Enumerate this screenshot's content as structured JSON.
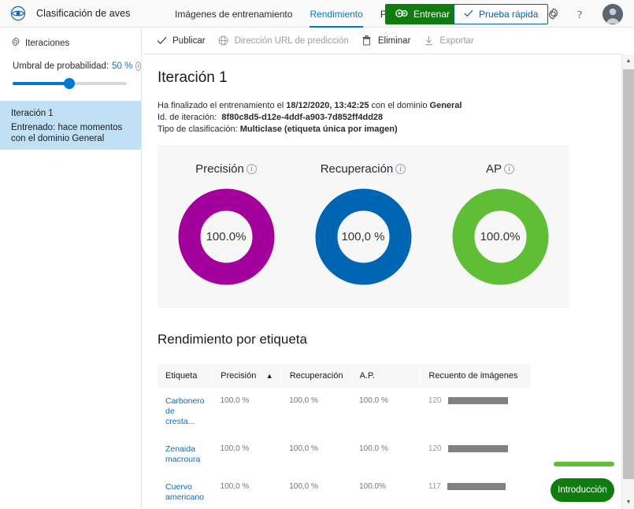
{
  "header": {
    "logo_icon": "eye-icon",
    "project_title": "Clasificación de aves",
    "tabs": [
      {
        "label": "Imágenes de entrenamiento",
        "active": false
      },
      {
        "label": "Rendimiento",
        "active": true
      },
      {
        "label": "Predicciones",
        "active": false
      }
    ],
    "train_button": "Entrenar",
    "quick_test_button": "Prueba rápida",
    "settings_icon": "gear-icon",
    "help_icon": "help-question-icon",
    "avatar_icon": "user-avatar-icon",
    "accent_blue": "#0078d4",
    "train_green": "#107c10"
  },
  "sidebar": {
    "section_title": "Iteraciones",
    "section_icon": "gear-icon",
    "threshold_label": "Umbral de probabilidad:",
    "threshold_value": "50 %",
    "threshold_info_icon": "info-icon",
    "threshold_percent": 50,
    "iteration": {
      "name": "Iteración 1",
      "status": "Entrenado: hace momentos con el dominio General",
      "selected": true,
      "highlight_color": "#bfe0f5"
    }
  },
  "commandbar": {
    "items": [
      {
        "label": "Publicar",
        "icon": "check-icon",
        "disabled": false
      },
      {
        "label": "Dirección URL de predicción",
        "icon": "globe-icon",
        "disabled": true
      },
      {
        "label": "Eliminar",
        "icon": "trash-icon",
        "disabled": false
      },
      {
        "label": "Exportar",
        "icon": "download-icon",
        "disabled": true
      }
    ]
  },
  "main": {
    "page_title": "Iteración 1",
    "meta": {
      "line1_pre": "Ha finalizado el entrenamiento el ",
      "line1_date": "18/12/2020, 13:42:25",
      "line1_mid": " con el dominio ",
      "line1_domain": "General",
      "line2_label": "Id. de iteración:",
      "line2_value": "8f80c8d5-d12e-4ddf-a903-7d852ff4dd28",
      "line3_label": "Tipo de clasificación:",
      "line3_value": "Multiclase (etiqueta única por imagen)"
    },
    "per_tag_title": "Rendimiento por etiqueta"
  },
  "chart_data": [
    {
      "type": "pie",
      "title": "Precisión",
      "info_icon": "info-icon",
      "value_label": "100.0%",
      "value": 100,
      "max": 100,
      "color": "#a4009b",
      "track": "#f7f7f7"
    },
    {
      "type": "pie",
      "title": "Recuperación",
      "info_icon": "info-icon",
      "value_label": "100,0 %",
      "value": 100,
      "max": 100,
      "color": "#0066b4",
      "track": "#f7f7f7"
    },
    {
      "type": "pie",
      "title": "AP",
      "info_icon": "info-icon",
      "value_label": "100.0%",
      "value": 100,
      "max": 100,
      "color": "#5fbe36",
      "track": "#f7f7f7"
    }
  ],
  "table": {
    "columns": [
      {
        "label": "Etiqueta",
        "sorted": false
      },
      {
        "label": "Precisión",
        "sorted": true,
        "sort_icon": "caret-up-icon"
      },
      {
        "label": "Recuperación",
        "sorted": false
      },
      {
        "label": "A.P.",
        "sorted": false
      },
      {
        "label": "Recuento de imágenes",
        "sorted": false
      }
    ],
    "rows": [
      {
        "tag": "Carbonero de cresta...",
        "precision": "100,0 %",
        "recall": "100,0 %",
        "ap": "100,0 %",
        "count": "120",
        "bar_pct": 100
      },
      {
        "tag": "Zenaida macroura",
        "precision": "100,0 %",
        "recall": "100,0 %",
        "ap": "100,0 %",
        "count": "120",
        "bar_pct": 100
      },
      {
        "tag": "Cuervo americano",
        "precision": "100,0 %",
        "recall": "100,0 %",
        "ap": "100.0%",
        "count": "117",
        "bar_pct": 98
      }
    ]
  },
  "floating": {
    "intro_button": "Introducción",
    "pill_color": "#5fbe36"
  },
  "scrollbar": {
    "up_icon": "caret-up-icon",
    "down_icon": "caret-down-icon"
  }
}
